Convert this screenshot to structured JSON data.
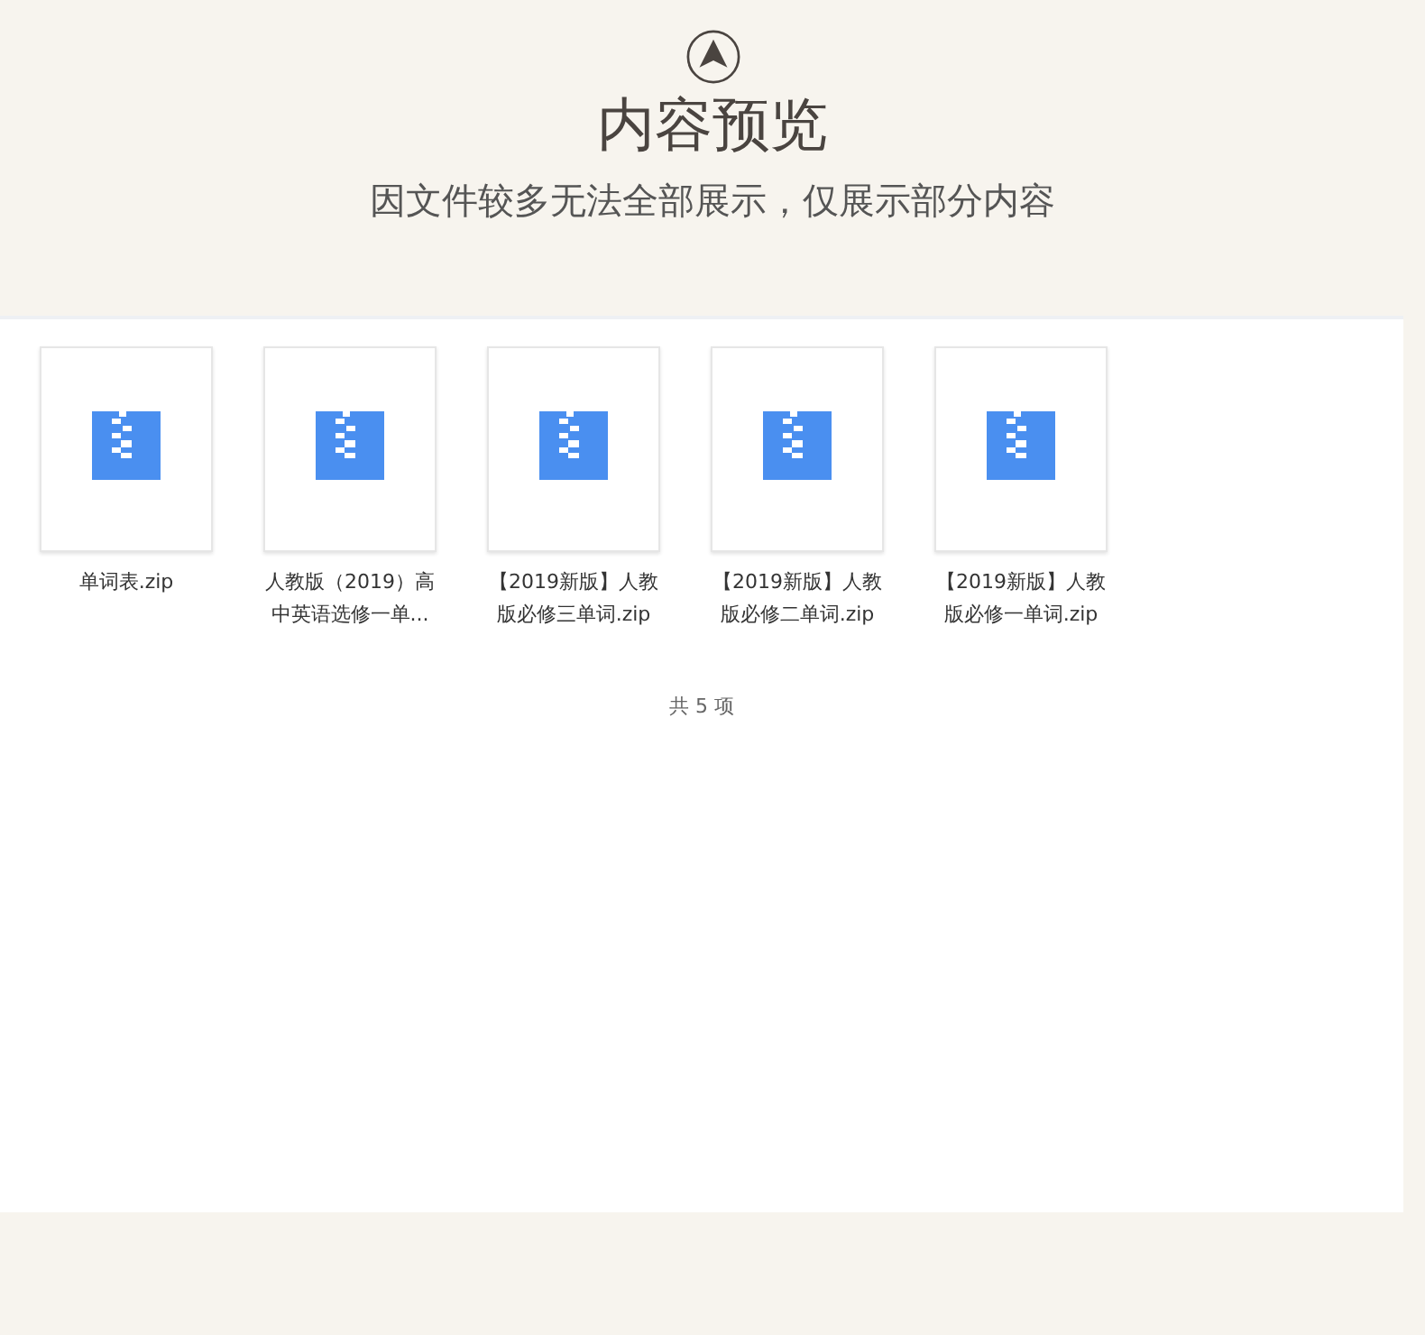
{
  "header": {
    "title": "内容预览",
    "subtitle": "因文件较多无法全部展示，仅展示部分内容"
  },
  "files": [
    {
      "kind": "zip",
      "name_lines": [
        "单词表.zip"
      ]
    },
    {
      "kind": "zip",
      "name_lines": [
        "人教版（2019）高",
        "中英语选修一单..."
      ]
    },
    {
      "kind": "zip",
      "name_lines": [
        "【2019新版】人教",
        "版必修三单词.zip"
      ]
    },
    {
      "kind": "zip",
      "name_lines": [
        "【2019新版】人教",
        "版必修二单词.zip"
      ]
    },
    {
      "kind": "zip",
      "name_lines": [
        "【2019新版】人教",
        "版必修一单词.zip"
      ]
    }
  ],
  "count": "共 5 项"
}
